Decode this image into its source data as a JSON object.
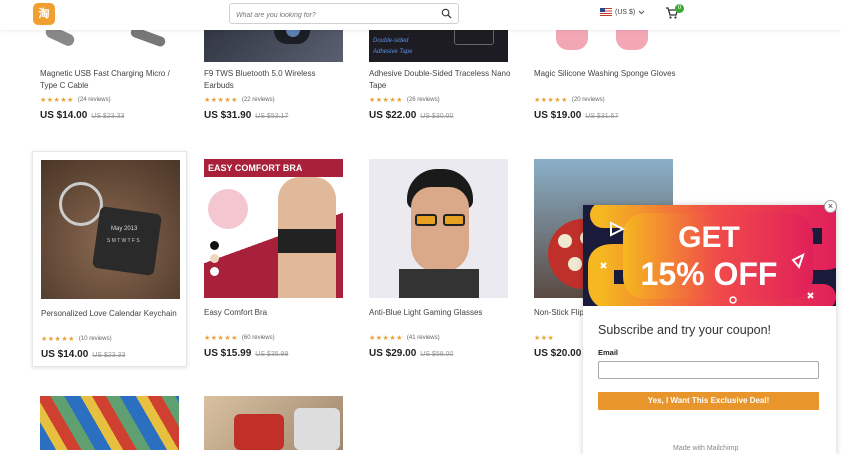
{
  "header": {
    "logo_text": "淘",
    "search_placeholder": "What are you looking for?",
    "currency": "(US $)",
    "cart_count": "0"
  },
  "products": [
    {
      "title": "Magnetic USB Fast Charging Micro / Type C Cable",
      "stars": "★★★★★",
      "reviews": "(24 reviews)",
      "price": "US $14.00",
      "old_price": "US $23.33"
    },
    {
      "title": "F9 TWS Bluetooth 5.0 Wireless Earbuds",
      "stars": "★★★★★",
      "reviews": "(22 reviews)",
      "price": "US $31.90",
      "old_price": "US $53.17"
    },
    {
      "title": "Adhesive Double-Sided Traceless Nano Tape",
      "stars": "★★★★★",
      "reviews": "(26 reviews)",
      "price": "US $22.00",
      "old_price": "US $30.00",
      "image_text": [
        "Double-sided",
        "Adhesive Tape"
      ]
    },
    {
      "title": "Magic Silicone Washing Sponge Gloves",
      "stars": "★★★★★",
      "reviews": "(20 reviews)",
      "price": "US $19.00",
      "old_price": "US $31.67"
    },
    {
      "title": "Personalized Love Calendar Keychain",
      "stars": "★★★★★",
      "reviews": "(10 reviews)",
      "price": "US $14.00",
      "old_price": "US $23.33",
      "image_text": [
        "May 2013",
        "S M T W T F S"
      ]
    },
    {
      "title": "Easy Comfort Bra",
      "stars": "★★★★★",
      "reviews": "(60 reviews)",
      "price": "US $15.99",
      "old_price": "US $35.99",
      "image_text": [
        "EASY COMFORT BRA"
      ]
    },
    {
      "title": "Anti-Blue Light Gaming Glasses",
      "stars": "★★★★★",
      "reviews": "(41 reviews)",
      "price": "US $29.00",
      "old_price": "US $58.00"
    },
    {
      "title": "Non-Stick Flip",
      "stars": "★★★",
      "reviews": "",
      "price": "US $20.00",
      "old_price": ""
    }
  ],
  "popup": {
    "banner_line1": "GET",
    "banner_line2": "15% OFF",
    "title": "Subscribe and try your coupon!",
    "email_label": "Email",
    "button_label": "Yes, I Want This Exclusive Deal!",
    "footer": "Made with Mailchimp",
    "close_label": "×"
  },
  "colors": {
    "star": "#e8a33c",
    "button": "#e8962c",
    "banner_bg": "#1a1a3a"
  }
}
